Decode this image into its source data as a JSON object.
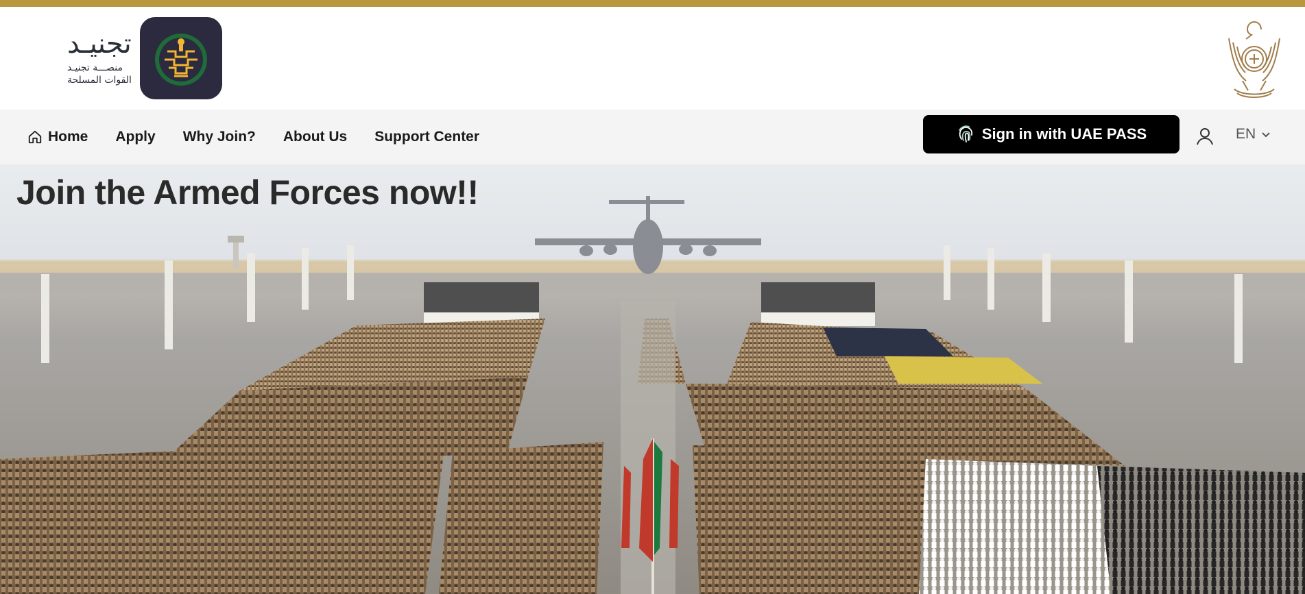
{
  "colors": {
    "gold_accent": "#b8973e",
    "nav_bg": "#f4f4f4",
    "uaepass_bg": "#000000",
    "logo_badge_bg": "#2c2a3e"
  },
  "header": {
    "logo": {
      "main_text": "تجنيـد",
      "sub_line_1": "منصـــة تجنيـد",
      "sub_line_2": "القوات المسلحة"
    },
    "emblem_icon": "uae-emblem-icon"
  },
  "nav": {
    "items": [
      {
        "label": "Home",
        "icon": "home-icon"
      },
      {
        "label": "Apply"
      },
      {
        "label": "Why Join?"
      },
      {
        "label": "About Us"
      },
      {
        "label": "Support Center"
      }
    ],
    "uaepass_label": "Sign in with UAE PASS",
    "uaepass_icon": "fingerprint-icon",
    "user_icon": "user-icon",
    "language": "EN",
    "language_icon": "chevron-down-icon"
  },
  "hero": {
    "title": "Join the Armed Forces now!!"
  }
}
